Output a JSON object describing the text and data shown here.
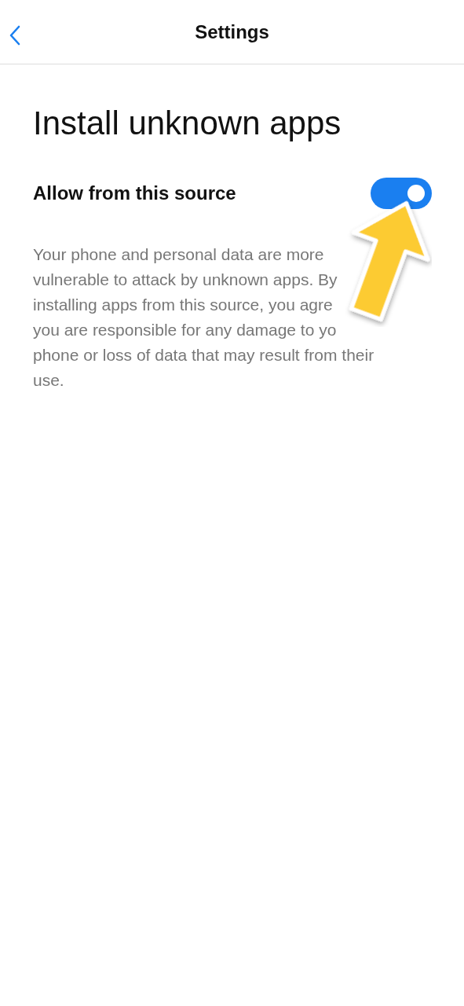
{
  "header": {
    "title": "Settings"
  },
  "page_title": "Install unknown apps",
  "setting": {
    "label": "Allow from this source",
    "on": true
  },
  "description_lines": [
    "Your phone and personal data are more",
    "vulnerable to attack by unknown apps. By",
    "installing apps from this source, you agre",
    "you are responsible for any damage to yo",
    "phone or loss of data that may result from their",
    "use."
  ]
}
